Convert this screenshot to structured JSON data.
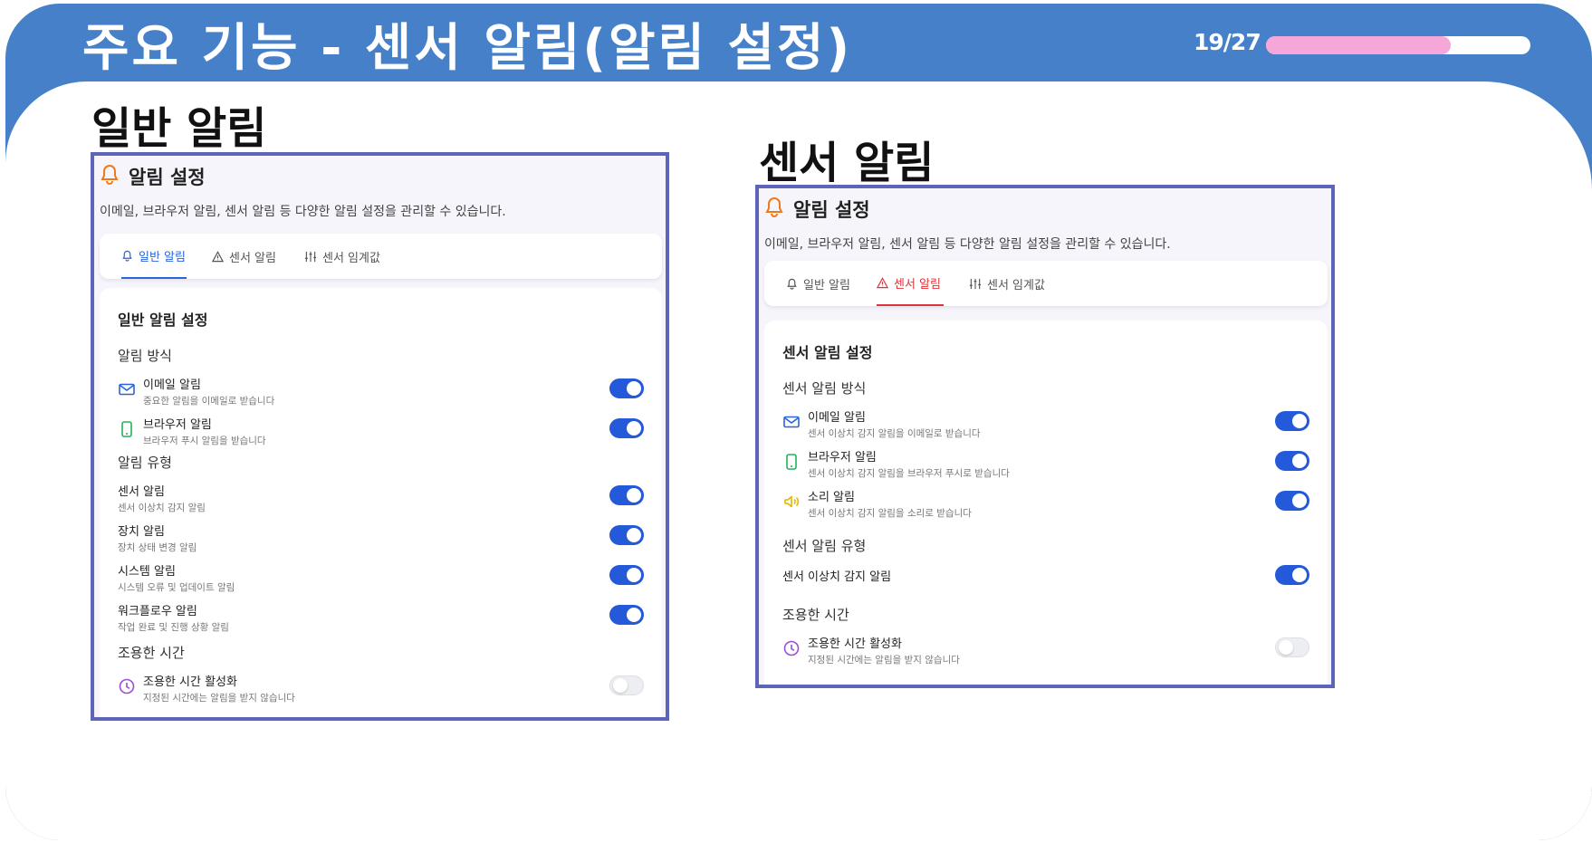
{
  "slide": {
    "title": "주요 기능 - 센서 알림(알림 설정)",
    "page": "19/27",
    "progress": 0.7
  },
  "left_heading": "일반 알림",
  "right_heading": "센서 알림",
  "left_panel": {
    "title": "알림 설정",
    "description": "이메일, 브라우저 알림, 센서 알림 등 다양한 알림 설정을 관리할 수 있습니다.",
    "tabs": [
      {
        "label": "일반 알림",
        "icon": "bell-icon",
        "active": true
      },
      {
        "label": "센서 알림",
        "icon": "warning-icon",
        "active": false
      },
      {
        "label": "센서 임계값",
        "icon": "sliders-icon",
        "active": false
      }
    ],
    "card_title": "일반 알림 설정",
    "groups": {
      "method": "알림 방식",
      "type": "알림 유형",
      "quiet": "조용한 시간"
    },
    "rows": [
      {
        "label": "이메일 알림",
        "sub": "중요한 알림을 이메일로 받습니다",
        "icon": "mail-icon",
        "on": true
      },
      {
        "label": "브라우저 알림",
        "sub": "브라우저 푸시 알림을 받습니다",
        "icon": "phone-icon",
        "on": true
      },
      {
        "label": "센서 알림",
        "sub": "센서 이상치 감지 알림",
        "on": true
      },
      {
        "label": "장치 알림",
        "sub": "장치 상태 변경 알림",
        "on": true
      },
      {
        "label": "시스템 알림",
        "sub": "시스템 오류 및 업데이트 알림",
        "on": true
      },
      {
        "label": "워크플로우 알림",
        "sub": "작업 완료 및 진행 상황 알림",
        "on": true
      },
      {
        "label": "조용한 시간 활성화",
        "sub": "지정된 시간에는 알림을 받지 않습니다",
        "icon": "clock-icon",
        "on": false
      }
    ]
  },
  "right_panel": {
    "title": "알림 설정",
    "description": "이메일, 브라우저 알림, 센서 알림 등 다양한 알림 설정을 관리할 수 있습니다.",
    "tabs": [
      {
        "label": "일반 알림",
        "icon": "bell-icon",
        "active": false
      },
      {
        "label": "센서 알림",
        "icon": "warning-icon",
        "active": true
      },
      {
        "label": "센서 임계값",
        "icon": "sliders-icon",
        "active": false
      }
    ],
    "card_title": "센서 알림 설정",
    "groups": {
      "method": "센서 알림 방식",
      "type": "센서 알림 유형",
      "quiet": "조용한 시간"
    },
    "rows": [
      {
        "label": "이메일 알림",
        "sub": "센서 이상치 감지 알림을 이메일로 받습니다",
        "icon": "mail-icon",
        "on": true
      },
      {
        "label": "브라우저 알림",
        "sub": "센서 이상치 감지 알림을 브라우저 푸시로 받습니다",
        "icon": "phone-icon",
        "on": true
      },
      {
        "label": "소리 알림",
        "sub": "센서 이상치 감지 알림을 소리로 받습니다",
        "icon": "speaker-icon",
        "on": true
      },
      {
        "label": "센서 이상치 감지 알림",
        "on": true
      },
      {
        "label": "조용한 시간 활성화",
        "sub": "지정된 시간에는 알림을 받지 않습니다",
        "icon": "clock-icon",
        "on": false
      }
    ]
  },
  "colors": {
    "header_blue": "#4580c8",
    "progress_pink": "#f5a7d9",
    "panel_border": "#5d65b8",
    "toggle_on": "#2459d9",
    "active_tab_blue": "#2a64d9",
    "active_tab_red": "#e0343a",
    "bell_orange": "#f07a1a"
  }
}
